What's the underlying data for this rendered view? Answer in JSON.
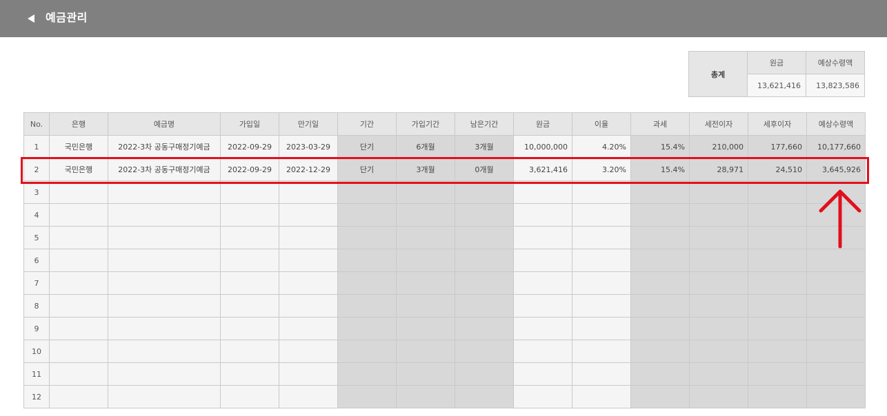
{
  "header": {
    "title": "예금관리"
  },
  "summary": {
    "label": "총계",
    "head_principal": "원금",
    "head_expected": "예상수령액",
    "principal": "13,621,416",
    "expected": "13,823,586"
  },
  "table": {
    "headers": [
      "No.",
      "은행",
      "예금명",
      "가입일",
      "만기일",
      "기간",
      "가입기간",
      "남은기간",
      "원금",
      "이율",
      "과세",
      "세전이자",
      "세후이자",
      "예상수령액"
    ],
    "rows": [
      {
        "no": "1",
        "bank": "국민은행",
        "name": "2022-3차 공동구매정기예금",
        "join": "2022-09-29",
        "maturity": "2023-03-29",
        "term": "단기",
        "period": "6개월",
        "remaining": "3개월",
        "principal": "10,000,000",
        "rate": "4.20%",
        "tax": "15.4%",
        "pre_tax": "210,000",
        "post_tax": "177,660",
        "expected": "10,177,660"
      },
      {
        "no": "2",
        "bank": "국민은행",
        "name": "2022-3차 공동구매정기예금",
        "join": "2022-09-29",
        "maturity": "2022-12-29",
        "term": "단기",
        "period": "3개월",
        "remaining": "0개월",
        "principal": "3,621,416",
        "rate": "3.20%",
        "tax": "15.4%",
        "pre_tax": "28,971",
        "post_tax": "24,510",
        "expected": "3,645,926"
      },
      {
        "no": "3"
      },
      {
        "no": "4"
      },
      {
        "no": "5"
      },
      {
        "no": "6"
      },
      {
        "no": "7"
      },
      {
        "no": "8"
      },
      {
        "no": "9"
      },
      {
        "no": "10"
      },
      {
        "no": "11"
      },
      {
        "no": "12"
      }
    ]
  },
  "colors": {
    "highlight": "#e0101d",
    "topbar": "#808080"
  }
}
